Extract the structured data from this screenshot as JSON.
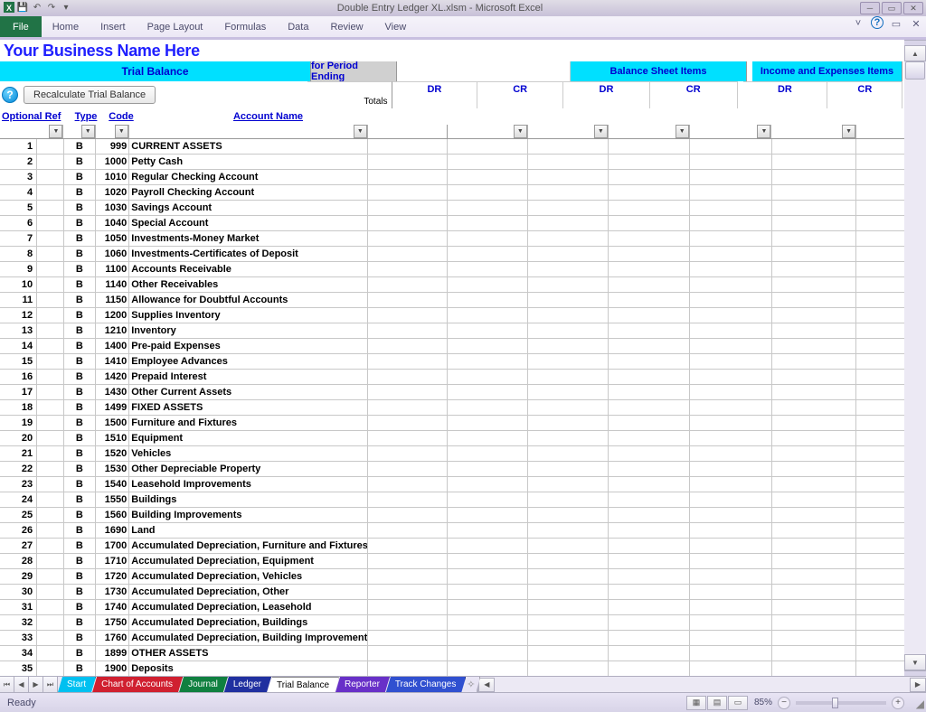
{
  "app": {
    "title": "Double Entry Ledger XL.xlsm - Microsoft Excel"
  },
  "ribbon": {
    "file": "File",
    "tabs": [
      "Home",
      "Insert",
      "Page Layout",
      "Formulas",
      "Data",
      "Review",
      "View"
    ]
  },
  "sheet": {
    "business_name": "Your Business Name Here",
    "headers": {
      "trial_balance": "Trial Balance",
      "period_ending": "for Period Ending",
      "balance_sheet": "Balance Sheet Items",
      "income_expenses": "Income and Expenses Items",
      "totals": "Totals",
      "dr": "DR",
      "cr": "CR",
      "optional_ref": "Optional Ref",
      "type": "Type",
      "code": "Code",
      "account_name": "Account Name"
    },
    "buttons": {
      "help": "?",
      "recalc": "Recalculate Trial Balance"
    },
    "rows": [
      {
        "n": 1,
        "t": "B",
        "c": "999",
        "name": "CURRENT ASSETS"
      },
      {
        "n": 2,
        "t": "B",
        "c": "1000",
        "name": "Petty Cash"
      },
      {
        "n": 3,
        "t": "B",
        "c": "1010",
        "name": "Regular Checking Account"
      },
      {
        "n": 4,
        "t": "B",
        "c": "1020",
        "name": "Payroll Checking Account"
      },
      {
        "n": 5,
        "t": "B",
        "c": "1030",
        "name": "Savings Account"
      },
      {
        "n": 6,
        "t": "B",
        "c": "1040",
        "name": "Special Account"
      },
      {
        "n": 7,
        "t": "B",
        "c": "1050",
        "name": "Investments-Money Market"
      },
      {
        "n": 8,
        "t": "B",
        "c": "1060",
        "name": "Investments-Certificates of Deposit"
      },
      {
        "n": 9,
        "t": "B",
        "c": "1100",
        "name": "Accounts Receivable"
      },
      {
        "n": 10,
        "t": "B",
        "c": "1140",
        "name": "Other Receivables"
      },
      {
        "n": 11,
        "t": "B",
        "c": "1150",
        "name": "Allowance for Doubtful Accounts"
      },
      {
        "n": 12,
        "t": "B",
        "c": "1200",
        "name": "Supplies Inventory"
      },
      {
        "n": 13,
        "t": "B",
        "c": "1210",
        "name": "Inventory"
      },
      {
        "n": 14,
        "t": "B",
        "c": "1400",
        "name": "Pre-paid Expenses"
      },
      {
        "n": 15,
        "t": "B",
        "c": "1410",
        "name": "Employee Advances"
      },
      {
        "n": 16,
        "t": "B",
        "c": "1420",
        "name": "Prepaid Interest"
      },
      {
        "n": 17,
        "t": "B",
        "c": "1430",
        "name": "Other Current Assets"
      },
      {
        "n": 18,
        "t": "B",
        "c": "1499",
        "name": "FIXED ASSETS"
      },
      {
        "n": 19,
        "t": "B",
        "c": "1500",
        "name": "Furniture and Fixtures"
      },
      {
        "n": 20,
        "t": "B",
        "c": "1510",
        "name": "Equipment"
      },
      {
        "n": 21,
        "t": "B",
        "c": "1520",
        "name": "Vehicles"
      },
      {
        "n": 22,
        "t": "B",
        "c": "1530",
        "name": "Other Depreciable Property"
      },
      {
        "n": 23,
        "t": "B",
        "c": "1540",
        "name": "Leasehold Improvements"
      },
      {
        "n": 24,
        "t": "B",
        "c": "1550",
        "name": "Buildings"
      },
      {
        "n": 25,
        "t": "B",
        "c": "1560",
        "name": "Building Improvements"
      },
      {
        "n": 26,
        "t": "B",
        "c": "1690",
        "name": "Land"
      },
      {
        "n": 27,
        "t": "B",
        "c": "1700",
        "name": "Accumulated Depreciation, Furniture and Fixtures"
      },
      {
        "n": 28,
        "t": "B",
        "c": "1710",
        "name": "Accumulated Depreciation, Equipment"
      },
      {
        "n": 29,
        "t": "B",
        "c": "1720",
        "name": "Accumulated Depreciation, Vehicles"
      },
      {
        "n": 30,
        "t": "B",
        "c": "1730",
        "name": "Accumulated Depreciation, Other"
      },
      {
        "n": 31,
        "t": "B",
        "c": "1740",
        "name": "Accumulated Depreciation, Leasehold"
      },
      {
        "n": 32,
        "t": "B",
        "c": "1750",
        "name": "Accumulated Depreciation, Buildings"
      },
      {
        "n": 33,
        "t": "B",
        "c": "1760",
        "name": "Accumulated Depreciation, Building Improvements"
      },
      {
        "n": 34,
        "t": "B",
        "c": "1899",
        "name": "OTHER ASSETS"
      },
      {
        "n": 35,
        "t": "B",
        "c": "1900",
        "name": "Deposits"
      }
    ]
  },
  "tabs": {
    "sheets": [
      {
        "label": "Start",
        "cls": "start"
      },
      {
        "label": "Chart of Accounts",
        "cls": "coa"
      },
      {
        "label": "Journal",
        "cls": "jrn"
      },
      {
        "label": "Ledger",
        "cls": "ldg"
      },
      {
        "label": "Trial Balance",
        "cls": "active"
      },
      {
        "label": "Reporter",
        "cls": "rep"
      },
      {
        "label": "Track Changes",
        "cls": "trk"
      }
    ]
  },
  "status": {
    "ready": "Ready",
    "zoom": "85%"
  }
}
